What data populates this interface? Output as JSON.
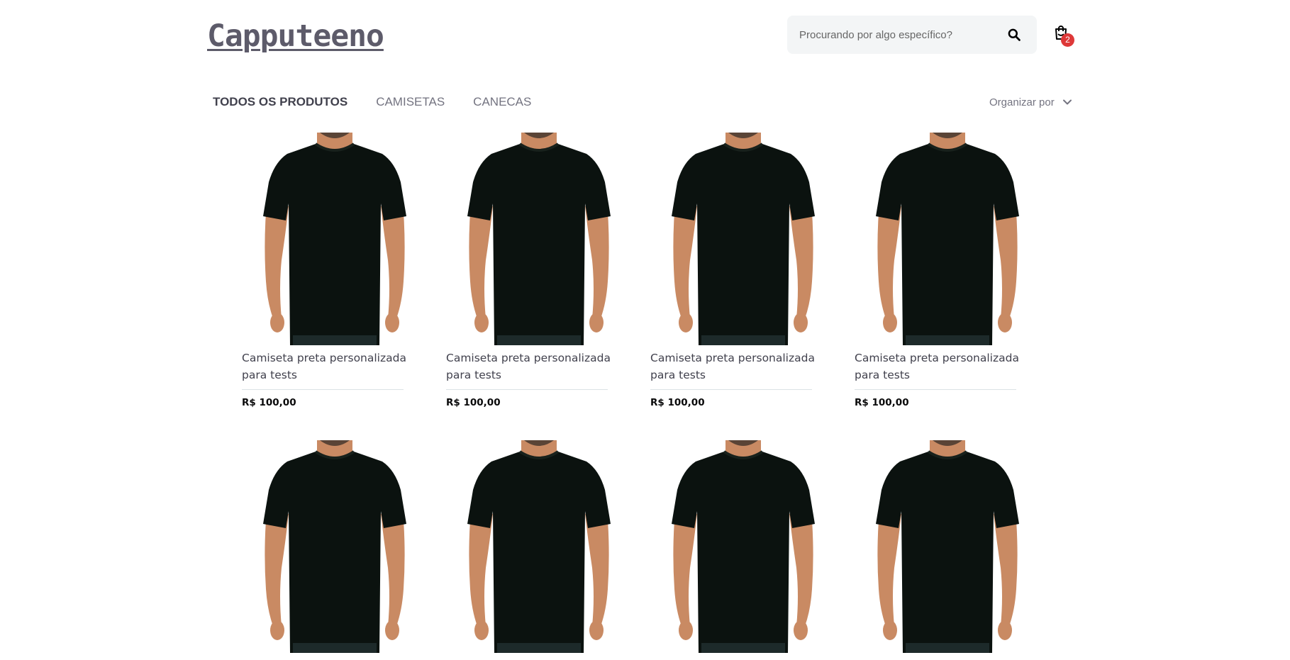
{
  "header": {
    "logo_text": "Capputeeno",
    "search": {
      "placeholder": "Procurando por algo específico?",
      "value": ""
    },
    "cart": {
      "count": "2"
    }
  },
  "filters": {
    "tabs": [
      {
        "label": "TODOS OS PRODUTOS",
        "active": true
      },
      {
        "label": "CAMISETAS",
        "active": false
      },
      {
        "label": "CANECAS",
        "active": false
      }
    ],
    "sort_label": "Organizar por"
  },
  "products": [
    {
      "name": "Camiseta preta personalizada para tests",
      "price": "R$ 100,00"
    },
    {
      "name": "Camiseta preta personalizada para tests",
      "price": "R$ 100,00"
    },
    {
      "name": "Camiseta preta personalizada para tests",
      "price": "R$ 100,00"
    },
    {
      "name": "Camiseta preta personalizada para tests",
      "price": "R$ 100,00"
    },
    {
      "name": "",
      "price": ""
    },
    {
      "name": "",
      "price": ""
    },
    {
      "name": "",
      "price": ""
    },
    {
      "name": "",
      "price": ""
    }
  ],
  "icons": {
    "search": "search-icon",
    "cart": "shopping-bag-icon",
    "sort": "chevron-down-icon"
  },
  "colors": {
    "logo": "#5d5b6a",
    "badge": "#de3838",
    "search_bg": "#f3f5f6",
    "shirt": "#0b120f",
    "skin": "#c98a63"
  }
}
